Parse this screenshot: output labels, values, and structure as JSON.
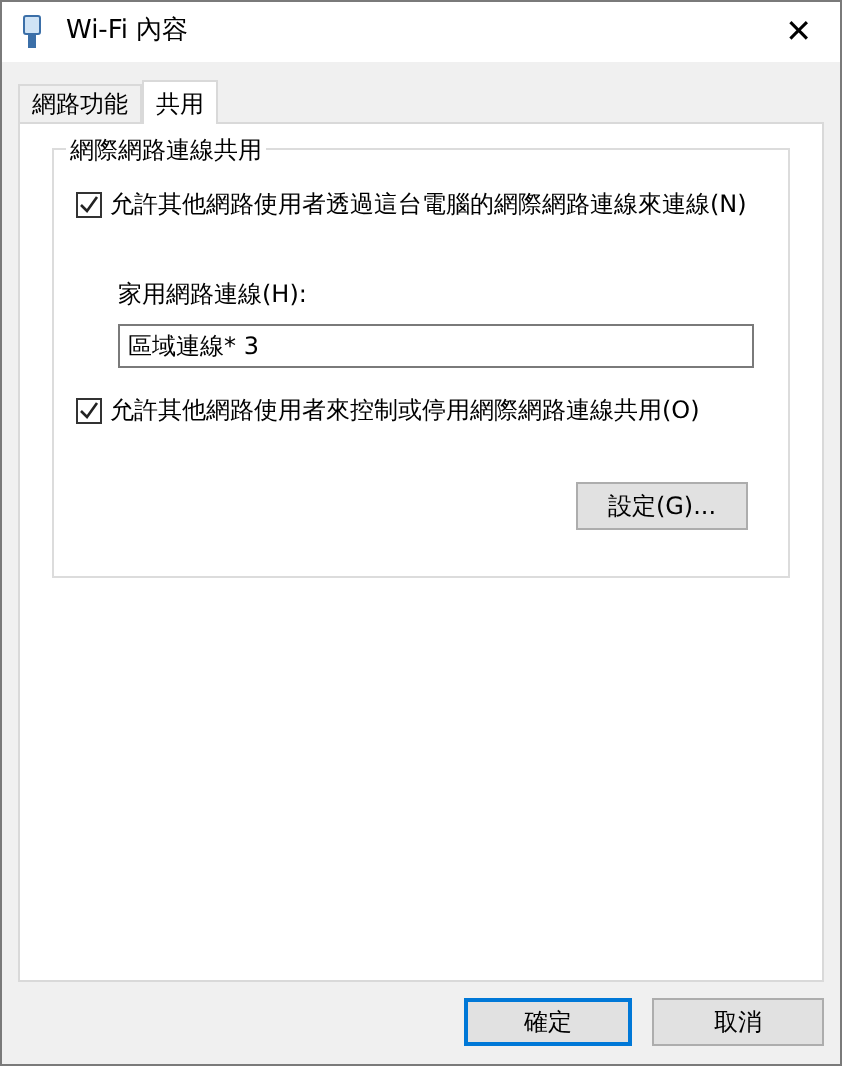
{
  "window": {
    "title": "Wi-Fi 內容",
    "close": "✕"
  },
  "tabs": [
    {
      "label": "網路功能",
      "selected": false
    },
    {
      "label": "共用",
      "selected": true
    }
  ],
  "group": {
    "title": "網際網路連線共用",
    "allow_connect": {
      "label": "允許其他網路使用者透過這台電腦的網際網路連線來連線(N)",
      "checked": true
    },
    "home_label": "家用網路連線(H):",
    "home_value": "區域連線* 3",
    "allow_control": {
      "label": "允許其他網路使用者來控制或停用網際網路連線共用(O)",
      "checked": true
    },
    "settings_button": "設定(G)..."
  },
  "buttons": [
    {
      "label": "確定",
      "default": true
    },
    {
      "label": "取消",
      "default": false
    }
  ]
}
